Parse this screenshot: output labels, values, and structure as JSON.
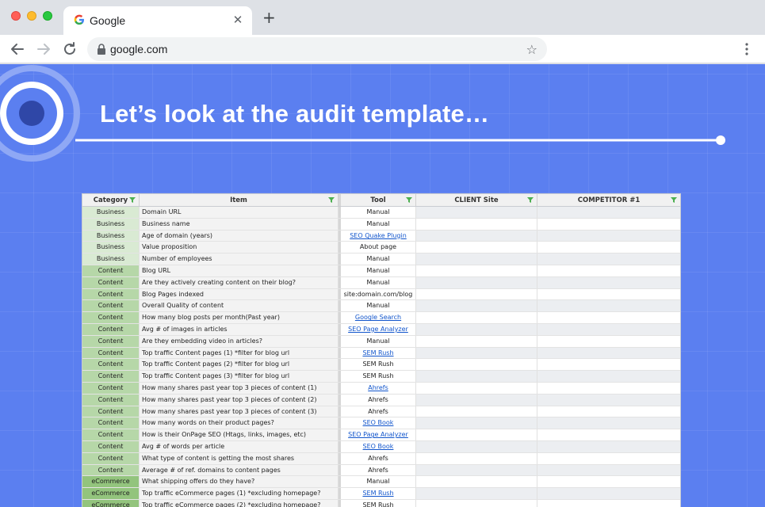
{
  "browser": {
    "tab_title": "Google",
    "url": "google.com"
  },
  "slide": {
    "title": "Let’s look at the audit template…",
    "accent_color": "#5b7ff0"
  },
  "sheet": {
    "headers": [
      "Category",
      "Item",
      "Tool",
      "CLIENT Site",
      "COMPETITOR #1"
    ],
    "rows": [
      {
        "category": "Business",
        "item": "Domain URL",
        "tool": "Manual",
        "tool_link": false
      },
      {
        "category": "Business",
        "item": "Business name",
        "tool": "Manual",
        "tool_link": false
      },
      {
        "category": "Business",
        "item": "Age of domain (years)",
        "tool": "SEO Quake Plugin",
        "tool_link": true
      },
      {
        "category": "Business",
        "item": "Value proposition",
        "tool": "About page",
        "tool_link": false
      },
      {
        "category": "Business",
        "item": "Number of employees",
        "tool": "Manual",
        "tool_link": false
      },
      {
        "category": "Content",
        "item": "Blog URL",
        "tool": "Manual",
        "tool_link": false
      },
      {
        "category": "Content",
        "item": "Are they actively creating content on their blog?",
        "tool": "Manual",
        "tool_link": false
      },
      {
        "category": "Content",
        "item": "Blog Pages indexed",
        "tool": "site:domain.com/blog",
        "tool_link": false
      },
      {
        "category": "Content",
        "item": "Overall Quality of content",
        "tool": "Manual",
        "tool_link": false
      },
      {
        "category": "Content",
        "item": "How many blog posts per month(Past year)",
        "tool": "Google Search",
        "tool_link": true
      },
      {
        "category": "Content",
        "item": "Avg # of images in articles",
        "tool": "SEO Page Analyzer",
        "tool_link": true
      },
      {
        "category": "Content",
        "item": "Are they embedding video in articles?",
        "tool": "Manual",
        "tool_link": false
      },
      {
        "category": "Content",
        "item": "Top traffic Content pages (1) *filter for blog url",
        "tool": "SEM Rush",
        "tool_link": true
      },
      {
        "category": "Content",
        "item": "Top traffic Content pages (2) *filter for blog url",
        "tool": "SEM Rush",
        "tool_link": false
      },
      {
        "category": "Content",
        "item": "Top traffic Content pages (3) *filter for blog url",
        "tool": "SEM Rush",
        "tool_link": false
      },
      {
        "category": "Content",
        "item": "How many shares past year top 3 pieces of content (1)",
        "tool": "Ahrefs",
        "tool_link": true
      },
      {
        "category": "Content",
        "item": "How many shares past year top 3 pieces of content (2)",
        "tool": "Ahrefs",
        "tool_link": false
      },
      {
        "category": "Content",
        "item": "How many shares past year top 3 pieces of content (3)",
        "tool": "Ahrefs",
        "tool_link": false
      },
      {
        "category": "Content",
        "item": "How many words on their product pages?",
        "tool": "SEO Book",
        "tool_link": true
      },
      {
        "category": "Content",
        "item": "How is their OnPage SEO (Htags, links, images, etc)",
        "tool": "SEO Page Analyzer",
        "tool_link": true
      },
      {
        "category": "Content",
        "item": "Avg # of words per article",
        "tool": "SEO Book",
        "tool_link": true
      },
      {
        "category": "Content",
        "item": "What type of content is getting the most shares",
        "tool": "Ahrefs",
        "tool_link": false
      },
      {
        "category": "Content",
        "item": "Average # of ref. domains to content pages",
        "tool": "Ahrefs",
        "tool_link": false
      },
      {
        "category": "eCommerce",
        "item": "What shipping offers do they have?",
        "tool": "Manual",
        "tool_link": false
      },
      {
        "category": "eCommerce",
        "item": "Top traffic eCommerce pages (1) *excluding homepage?",
        "tool": "SEM Rush",
        "tool_link": true
      },
      {
        "category": "eCommerce",
        "item": "Top traffic eCommerce pages (2) *excluding homepage?",
        "tool": "SEM Rush",
        "tool_link": false
      }
    ]
  }
}
